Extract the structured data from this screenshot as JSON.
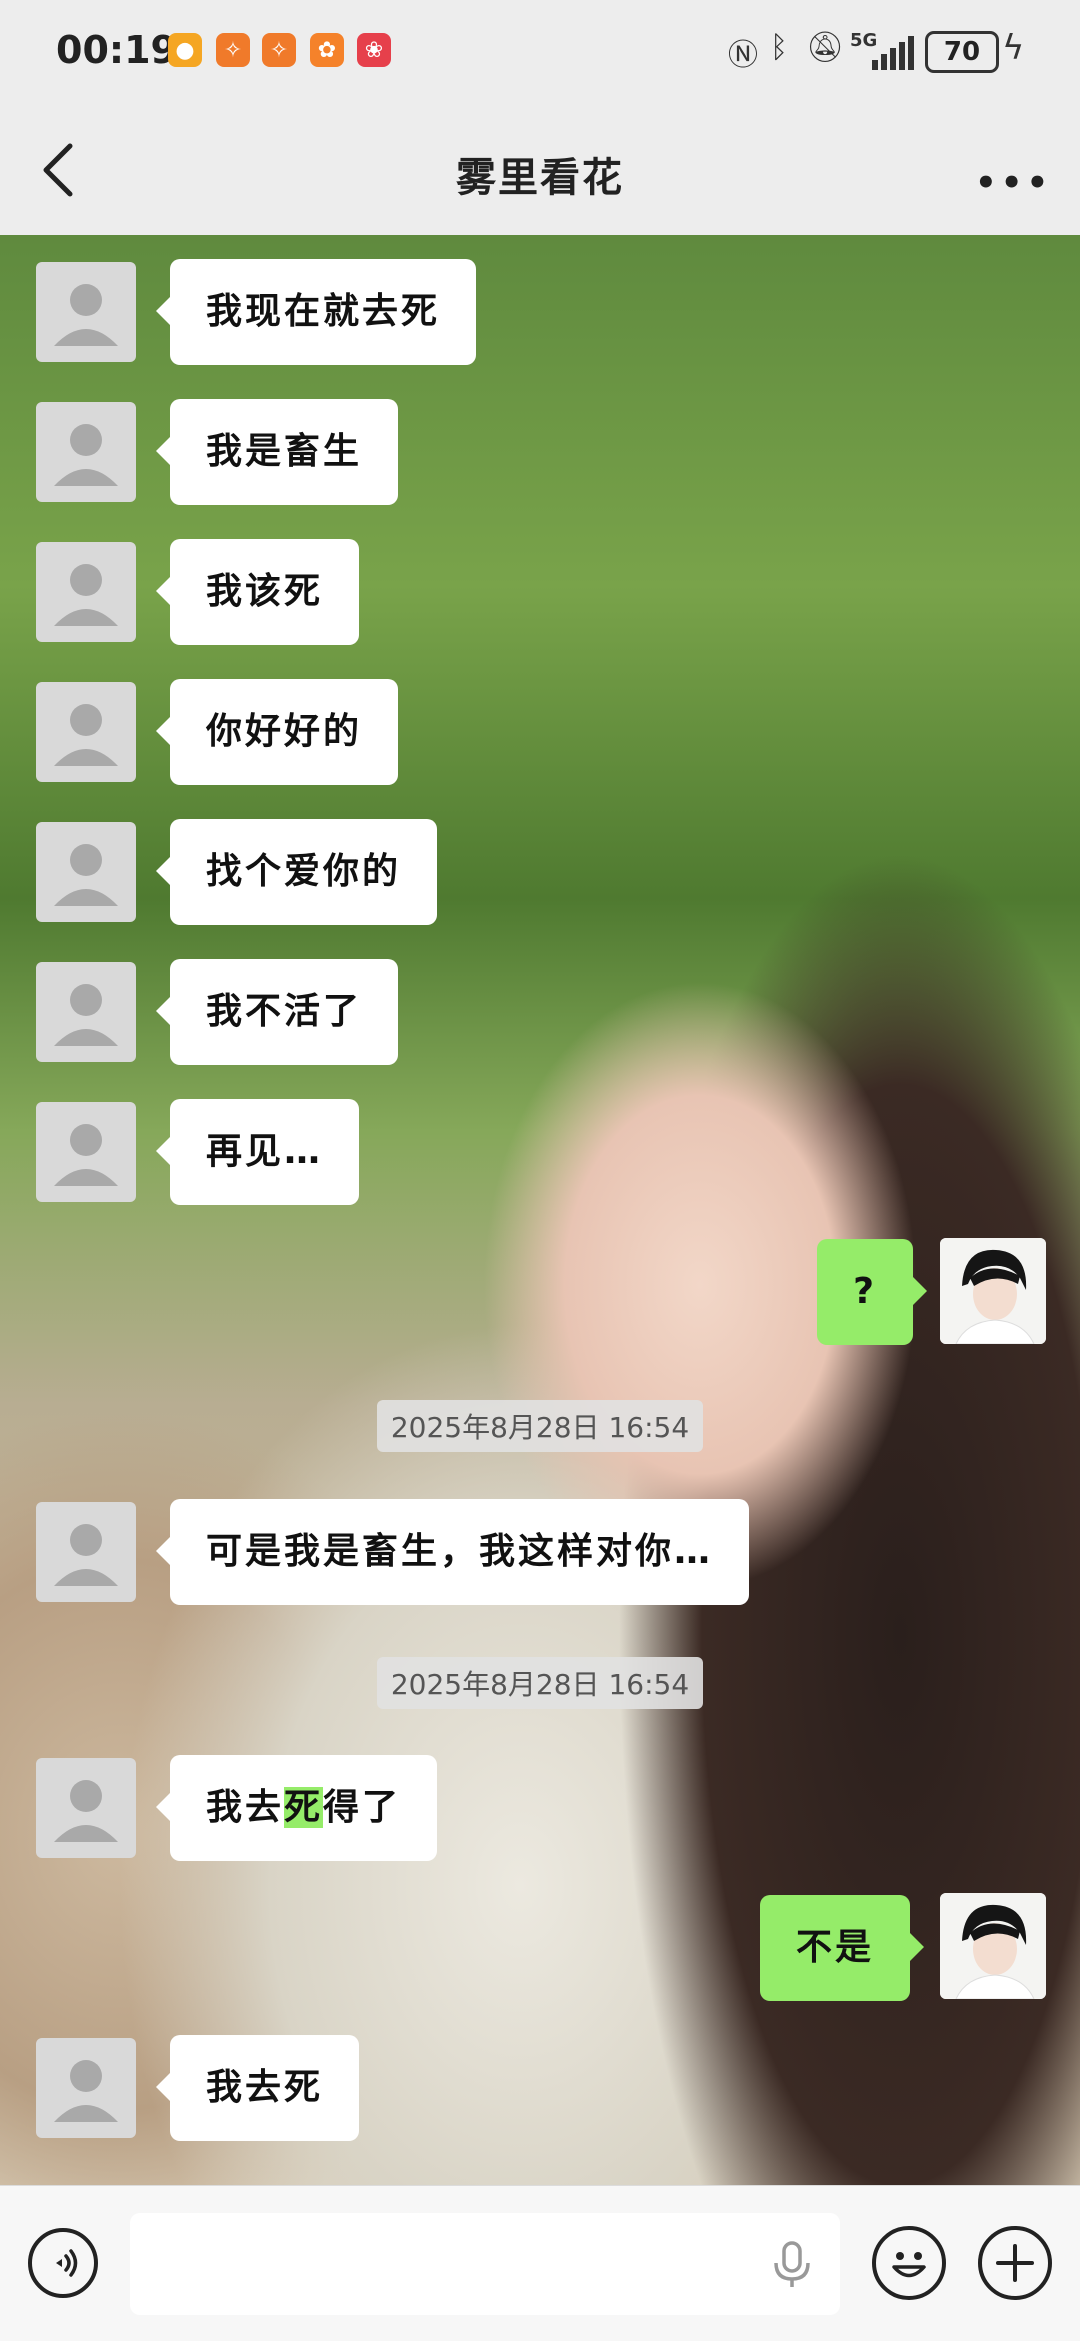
{
  "status_bar": {
    "time": "00:19",
    "network": "5G",
    "battery": "70",
    "notification_icons": [
      "weibo-icon",
      "app-icon",
      "app-icon",
      "app-icon",
      "huawei-icon"
    ]
  },
  "header": {
    "title": "雾里看花"
  },
  "messages": [
    {
      "side": "left",
      "text": "我现在就去死"
    },
    {
      "side": "left",
      "text": "我是畜生"
    },
    {
      "side": "left",
      "text": "我该死"
    },
    {
      "side": "left",
      "text": "你好好的"
    },
    {
      "side": "left",
      "text": "找个爱你的"
    },
    {
      "side": "left",
      "text": "我不活了"
    },
    {
      "side": "left",
      "text": "再见…"
    },
    {
      "side": "right",
      "text": "?"
    },
    {
      "type": "timestamp",
      "text": "2025年8月28日 16:54"
    },
    {
      "side": "left",
      "text": "可是我是畜生，我这样对你…"
    },
    {
      "type": "timestamp",
      "text": "2025年8月28日 16:54"
    },
    {
      "side": "left",
      "text_before": "我去",
      "text_highlight": "死",
      "text_after": "得了"
    },
    {
      "side": "right",
      "text": "不是"
    },
    {
      "side": "left",
      "text": "我去死"
    }
  ],
  "colors": {
    "my_bubble": "#95ec69",
    "their_bubble": "#ffffff",
    "bar_background": "#ededed"
  }
}
